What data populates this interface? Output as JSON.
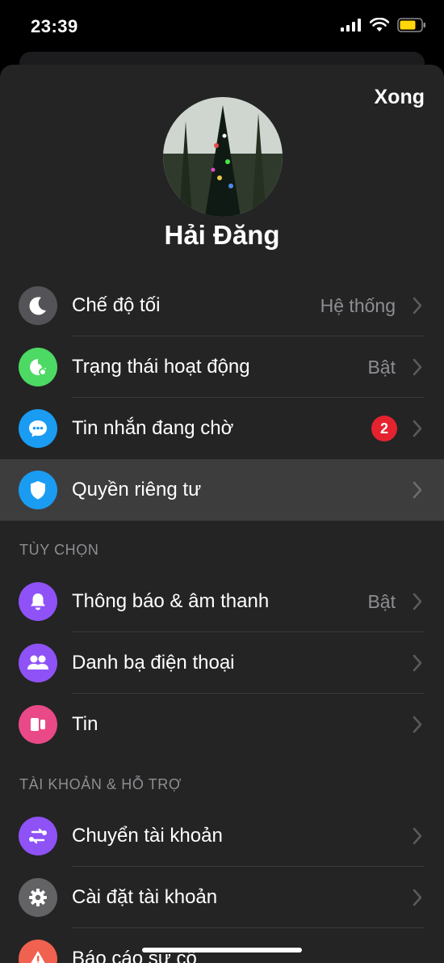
{
  "status_bar": {
    "time": "23:39"
  },
  "header": {
    "done_label": "Xong"
  },
  "profile": {
    "name": "Hải Đăng"
  },
  "main_rows": [
    {
      "label": "Chế độ tối",
      "value": "Hệ thống",
      "icon": "moon-icon",
      "color": "#545458"
    },
    {
      "label": "Trạng thái hoạt động",
      "value": "Bật",
      "icon": "active-status-icon",
      "color": "#4cd964"
    },
    {
      "label": "Tin nhắn đang chờ",
      "badge": "2",
      "icon": "message-bubble-icon",
      "color": "#1a9cf3"
    },
    {
      "label": "Quyền riêng tư",
      "icon": "shield-icon",
      "color": "#1a9cf3"
    }
  ],
  "preferences": {
    "header": "TÙY CHỌN",
    "rows": [
      {
        "label": "Thông báo & âm thanh",
        "value": "Bật",
        "icon": "bell-icon",
        "color": "#8e52f7"
      },
      {
        "label": "Danh bạ điện thoại",
        "icon": "contacts-icon",
        "color": "#8e52f7"
      },
      {
        "label": "Tin",
        "icon": "stories-icon",
        "color": "#e94a87"
      }
    ]
  },
  "account": {
    "header": "TÀI KHOẢN & HỖ TRỢ",
    "rows": [
      {
        "label": "Chuyển tài khoản",
        "icon": "switch-account-icon",
        "color": "#8e52f7"
      },
      {
        "label": "Cài đặt tài khoản",
        "icon": "gear-icon",
        "color": "#636366"
      },
      {
        "label": "Báo cáo sự cố",
        "icon": "warning-icon",
        "color": "#f0614f"
      }
    ]
  }
}
